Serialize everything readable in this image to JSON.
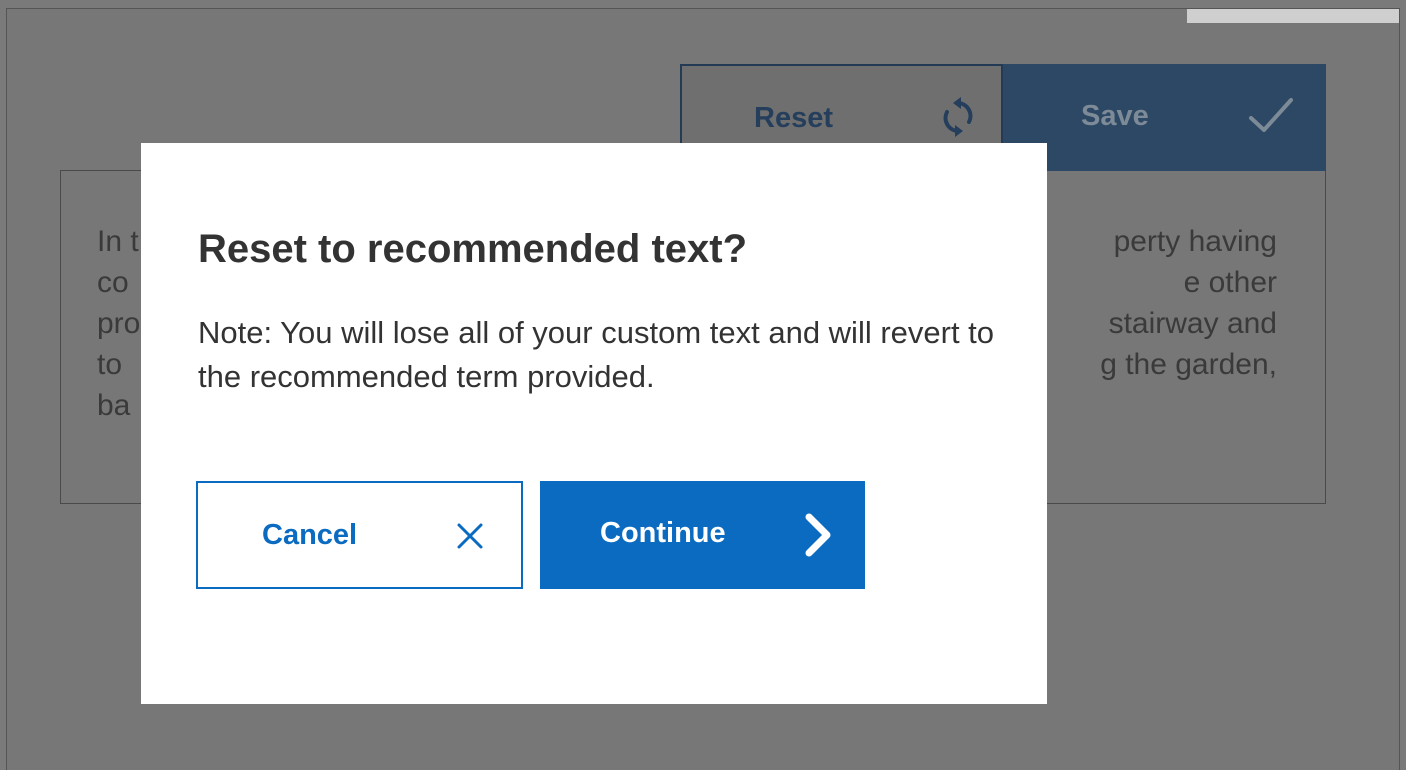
{
  "toolbar": {
    "reset_label": "Reset",
    "save_label": "Save"
  },
  "editor": {
    "text_fragments": [
      "In t",
      "co",
      "pro",
      "to",
      "ba",
      "perty having",
      "e other",
      "stairway and",
      "g the garden,"
    ]
  },
  "dialog": {
    "title": "Reset to recommended text?",
    "body": "Note: You will lose all of your custom text and will revert to the recommended term provided.",
    "cancel_label": "Cancel",
    "continue_label": "Continue"
  },
  "icons": {
    "reset": "refresh-icon",
    "save": "checkmark-icon",
    "cancel": "close-icon",
    "continue": "chevron-right-icon"
  },
  "colors": {
    "primary": "#0b6bc1",
    "overlay": "#777777",
    "dim_primary": "#2d4864",
    "text": "#333333"
  }
}
